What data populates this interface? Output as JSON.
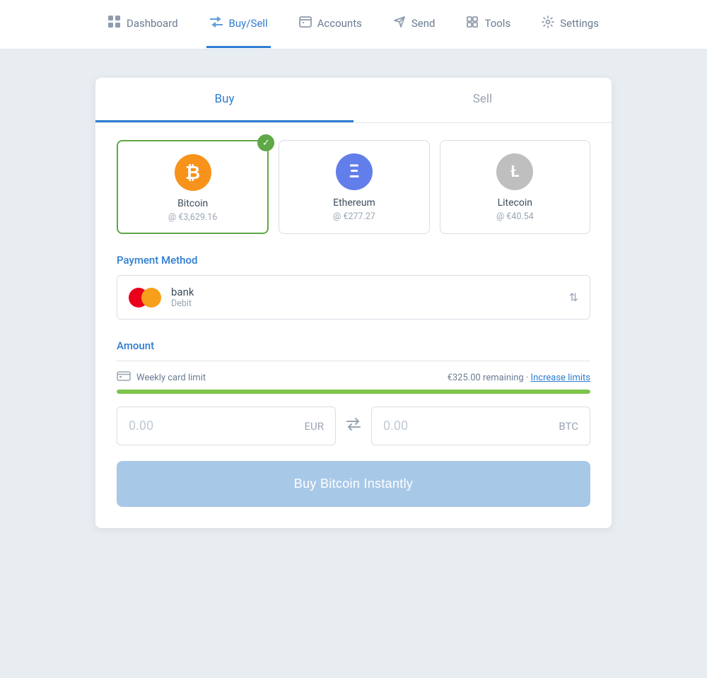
{
  "nav": {
    "items": [
      {
        "id": "dashboard",
        "label": "Dashboard",
        "icon": "⊞",
        "active": false
      },
      {
        "id": "buysell",
        "label": "Buy/Sell",
        "icon": "⇄",
        "active": true
      },
      {
        "id": "accounts",
        "label": "Accounts",
        "icon": "▤",
        "active": false
      },
      {
        "id": "send",
        "label": "Send",
        "icon": "◁",
        "active": false
      },
      {
        "id": "tools",
        "label": "Tools",
        "icon": "⊟",
        "active": false
      },
      {
        "id": "settings",
        "label": "Settings",
        "icon": "⚙",
        "active": false
      }
    ]
  },
  "tabs": [
    {
      "id": "buy",
      "label": "Buy",
      "active": true
    },
    {
      "id": "sell",
      "label": "Sell",
      "active": false
    }
  ],
  "crypto_options": [
    {
      "id": "btc",
      "name": "Bitcoin",
      "price": "@ €3,629.16",
      "icon_type": "btc",
      "selected": true
    },
    {
      "id": "eth",
      "name": "Ethereum",
      "price": "@ €277.27",
      "icon_type": "eth",
      "selected": false
    },
    {
      "id": "ltc",
      "name": "Litecoin",
      "price": "@ €40.54",
      "icon_type": "ltc",
      "selected": false
    }
  ],
  "payment_method": {
    "section_label": "Payment Method",
    "name": "bank",
    "type": "Debit"
  },
  "amount": {
    "section_label": "Amount",
    "weekly_limit_label": "Weekly card limit",
    "remaining": "€325.00 remaining",
    "separator": "·",
    "increase_label": "Increase limits",
    "progress_pct": 100,
    "eur_value": "0.00",
    "eur_currency": "EUR",
    "btc_value": "0.00",
    "btc_currency": "BTC"
  },
  "buy_button": {
    "label": "Buy Bitcoin Instantly"
  }
}
